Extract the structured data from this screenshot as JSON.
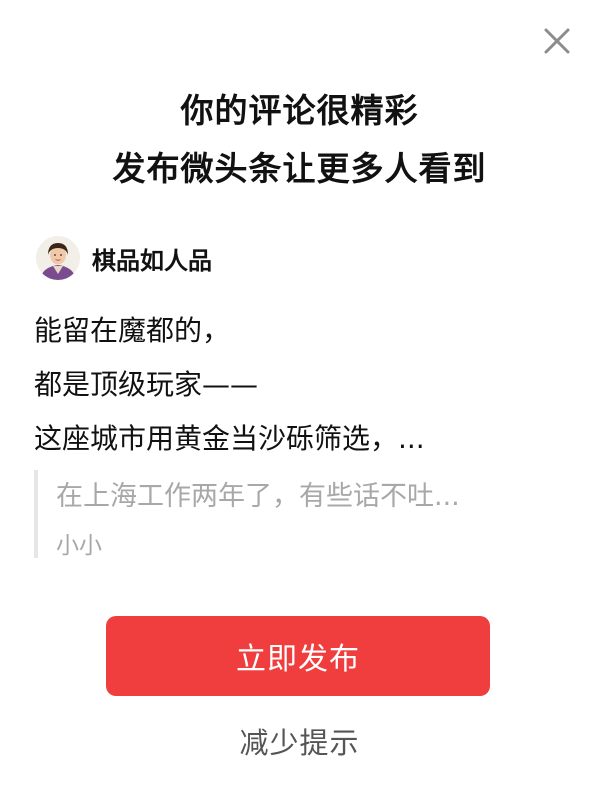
{
  "dialog": {
    "title_line1": "你的评论很精彩",
    "title_line2": "发布微头条让更多人看到"
  },
  "author": {
    "name": "棋品如人品"
  },
  "post": {
    "lines": [
      "能留在魔都的，",
      "都是顶级玩家——",
      "这座城市用黄金当沙砾筛选，..."
    ]
  },
  "quote": {
    "text": "在上海工作两年了，有些话不吐...",
    "author": "小小"
  },
  "actions": {
    "publish_label": "立即发布",
    "reduce_label": "减少提示"
  },
  "colors": {
    "accent": "#f03e3e",
    "muted_text": "#a8a8a8"
  },
  "icons": {
    "close": "close-icon"
  }
}
